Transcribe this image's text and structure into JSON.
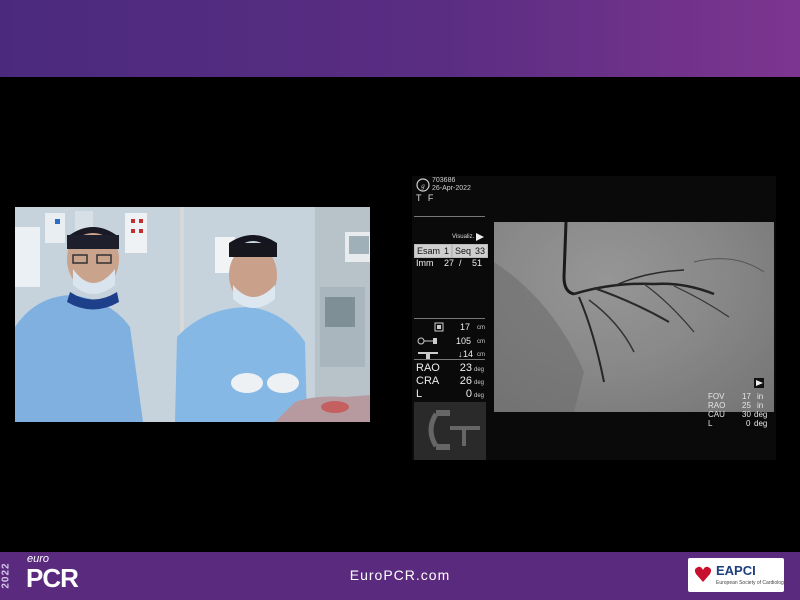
{
  "banner": {
    "year": "2022",
    "brand_small": "euro",
    "brand_large": "PCR",
    "url": "EuroPCR.com",
    "partner_name": "EAPCI",
    "partner_sub": "European Society of Cardiology"
  },
  "angio": {
    "patient_id": "703686",
    "date": "26-Apr-2022",
    "initials": "T F",
    "visualiz": "Visualiz.",
    "esam_label": "Esam",
    "esam_value": "1",
    "seq_label": "Seq",
    "seq_value": "33",
    "imm_label": "Imm",
    "imm_value": "27",
    "imm_sep": "/",
    "imm_total": "51",
    "distances": [
      {
        "value": "17",
        "unit": "cm"
      },
      {
        "value": "105",
        "unit": "cm"
      },
      {
        "value": "14",
        "unit": "cm"
      }
    ],
    "angles": [
      {
        "label": "RAO",
        "value": "23",
        "unit": "deg"
      },
      {
        "label": "CRA",
        "value": "26",
        "unit": "deg"
      },
      {
        "label": "L",
        "value": "0",
        "unit": "deg"
      }
    ],
    "overlay": [
      {
        "label": "FOV",
        "value": "17",
        "unit": "in"
      },
      {
        "label": "RAO",
        "value": "25",
        "unit": "in"
      },
      {
        "label": "CAU",
        "value": "30",
        "unit": "deg"
      },
      {
        "label": "L",
        "value": "0",
        "unit": "deg"
      }
    ]
  },
  "colors": {
    "banner_purple": "#5a2a7f",
    "ge_blue": "#cfcfcf",
    "heart_red": "#c8102e"
  }
}
